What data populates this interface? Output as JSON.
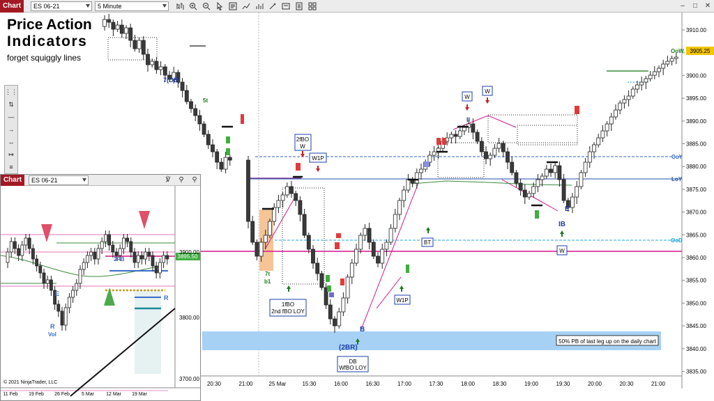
{
  "toolbar": {
    "tab_label": "Chart",
    "instrument": "ES 06-21",
    "interval": "5 Minute"
  },
  "overlay_title": {
    "line1": "Price Action",
    "line2": "Indicators",
    "line3": "forget squiggly lines"
  },
  "main_chart": {
    "price_axis": [
      "3910.00",
      "3905.00",
      "3900.00",
      "3895.00",
      "3890.00",
      "3885.00",
      "3880.00",
      "3875.00",
      "3870.00",
      "3865.00",
      "3860.00",
      "3855.00",
      "3850.00",
      "3845.00",
      "3840.00",
      "3835.00"
    ],
    "time_axis": [
      "20:30",
      "21:00",
      "25 Mar",
      "15:30",
      "16:00",
      "16:30",
      "17:00",
      "17:30",
      "18:00",
      "18:30",
      "19:00",
      "19:30",
      "20:00",
      "20:30",
      "21:00"
    ],
    "current_price": "3905.25",
    "line_labels": {
      "oow": "OoW",
      "coy": "CoY",
      "loy": "LoY",
      "ood": "OoD"
    },
    "annotations": {
      "ob": "7(OB)",
      "five_t": "5t",
      "seven_t": "7t",
      "b1": "b1",
      "two_fbo": "2fBO",
      "two_fbo_w": "W",
      "w1p_top": "W1P",
      "one_fbo": "1fBO",
      "second_fbo_loy": "2nd fBO LOY",
      "b_label": "B",
      "two_br": "(2BR)",
      "db": "DB",
      "wfbo_loy": "WfBO LOY",
      "w1p_bottom": "W1P",
      "bt": "BT",
      "w_a": "W",
      "w_b": "W",
      "two_bars": "II",
      "e_label": "E",
      "ib_label": "IB",
      "w_c": "W",
      "pb_note": "50% PB of last leg up on the daily chart"
    },
    "colors": {
      "bull": "#ffffff",
      "bear": "#3a3a3a",
      "loy_line": "#2255aa",
      "coy_line": "#3366cc",
      "ood_line": "#1aa8e0",
      "magenta": "#d4148c",
      "annotation_blue": "#1b3fa8"
    }
  },
  "inset_chart": {
    "tab_label": "Chart",
    "instrument": "ES 06-21",
    "price_axis": [
      "3900.00",
      "3800.00",
      "3700.00"
    ],
    "price_tag": "3895.50",
    "date_axis": [
      "11 Feb",
      "19 Feb",
      "26 Feb",
      "5 Mar",
      "12 Mar",
      "19 Mar"
    ],
    "labels": {
      "e": "E",
      "r_vol": "R",
      "vol": "Vol",
      "two_pb": "2PB",
      "r": "R"
    },
    "copyright": "© 2021 NinjaTrader, LLC"
  }
}
